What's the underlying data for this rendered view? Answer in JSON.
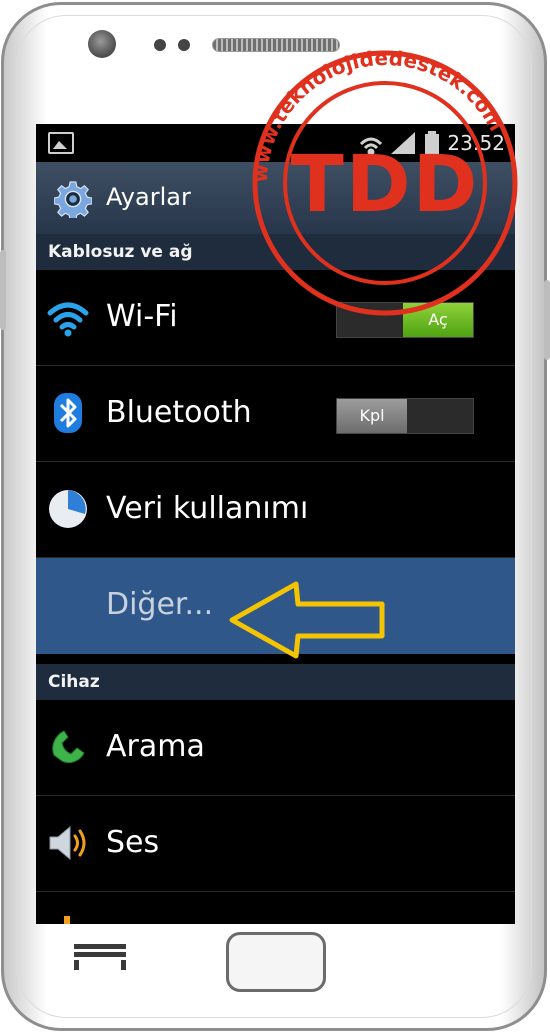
{
  "status_bar": {
    "time": "23:52",
    "icons": [
      "gallery-notification-icon",
      "wifi-icon",
      "signal-icon",
      "battery-icon"
    ]
  },
  "title_bar": {
    "title": "Ayarlar",
    "icon": "settings-gear-icon"
  },
  "sections": [
    {
      "header": "Kablosuz ve ağ",
      "items": [
        {
          "label": "Wi-Fi",
          "icon": "wifi-icon",
          "toggle": {
            "state": "on",
            "text": "Aç"
          }
        },
        {
          "label": "Bluetooth",
          "icon": "bluetooth-icon",
          "toggle": {
            "state": "off",
            "text": "Kpl"
          }
        },
        {
          "label": "Veri kullanımı",
          "icon": "data-usage-pie-icon"
        },
        {
          "label": "Diğer...",
          "icon": "",
          "selected": true
        }
      ]
    },
    {
      "header": "Cihaz",
      "items": [
        {
          "label": "Arama",
          "icon": "phone-icon"
        },
        {
          "label": "Ses",
          "icon": "speaker-icon"
        }
      ]
    }
  ],
  "watermark": {
    "stamp_text": "TDD",
    "ring_text": "www.teknolojidedestek.com"
  },
  "colors": {
    "title_bar": "#2f3e52",
    "section_header": "#1e2c3e",
    "selected_row": "#2f578a",
    "toggle_on": "#6cc02a",
    "arrow": "#f4c400",
    "stamp": "#e0301e"
  }
}
